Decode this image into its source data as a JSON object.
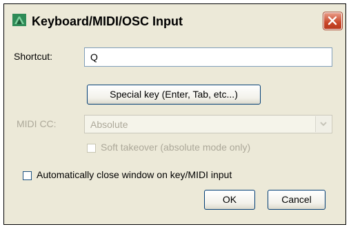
{
  "window": {
    "title": "Keyboard/MIDI/OSC Input"
  },
  "shortcut": {
    "label": "Shortcut:",
    "value": "Q"
  },
  "special_key_button": "Special key (Enter, Tab, etc...)",
  "midi_cc": {
    "label": "MIDI CC:",
    "selected": "Absolute",
    "enabled": false
  },
  "soft_takeover": {
    "label": "Soft takeover (absolute mode only)",
    "checked": false,
    "enabled": false
  },
  "auto_close": {
    "label": "Automatically close window on key/MIDI input",
    "checked": false
  },
  "buttons": {
    "ok": "OK",
    "cancel": "Cancel"
  }
}
